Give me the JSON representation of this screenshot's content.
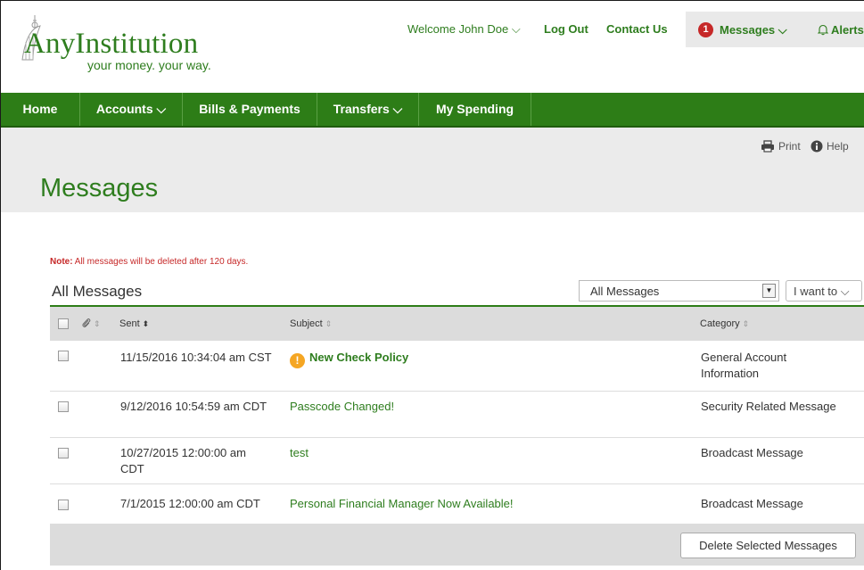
{
  "header": {
    "logo_main": "AnyInstitution",
    "logo_tagline": "your money. your way.",
    "welcome": "Welcome John Doe ⌵",
    "logout": "Log Out",
    "contact": "Contact Us",
    "messages_count": "1",
    "messages_label": "Messages ⌵",
    "alerts_label": "Alerts ⌵"
  },
  "nav": {
    "home": "Home",
    "accounts": "Accounts ⌵",
    "bills": "Bills & Payments",
    "transfers": "Transfers ⌵",
    "spending": "My Spending"
  },
  "titlebar": {
    "print": "Print",
    "help": "Help",
    "title": "Messages"
  },
  "note": {
    "label": "Note:",
    "text": " All messages will be deleted after 120 days."
  },
  "list": {
    "title": "All Messages",
    "filter_value": "All Messages",
    "i_want_to": "I want to ⌵"
  },
  "table": {
    "headers": {
      "sent": "Sent",
      "subject": "Subject",
      "category": "Category"
    },
    "rows": [
      {
        "sent": "11/15/2016 10:34:04 am CST",
        "subject": "New Check Policy",
        "category": "General Account Information",
        "unread": true,
        "urgent": true
      },
      {
        "sent": "9/12/2016 10:54:59 am CDT",
        "subject": "Passcode Changed!",
        "category": "Security Related Message",
        "unread": false,
        "urgent": false
      },
      {
        "sent": "10/27/2015 12:00:00 am CDT",
        "subject": "test",
        "category": "Broadcast Message",
        "unread": false,
        "urgent": false
      },
      {
        "sent": "7/1/2015 12:00:00 am CDT",
        "subject": "Personal Financial Manager Now Available!",
        "category": "Broadcast Message",
        "unread": false,
        "urgent": false
      }
    ],
    "delete_button": "Delete Selected Messages"
  },
  "icons": {
    "warning": "!",
    "attachment": "paperclip-icon",
    "print": "printer-icon",
    "help": "info-icon",
    "bell": "bell-icon"
  },
  "colors": {
    "brand_green": "#2d7d17",
    "link_green": "#2e7d1e",
    "badge_red": "#c62828",
    "warning_orange": "#f5a623"
  }
}
